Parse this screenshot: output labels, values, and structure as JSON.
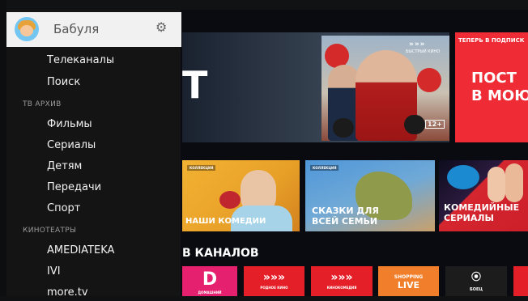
{
  "profile": {
    "name": "Бабуля",
    "settings_icon": "gear-icon",
    "avatar_icon": "avatar"
  },
  "menu": {
    "top_items": [
      {
        "label": "Телеканалы"
      },
      {
        "label": "Поиск"
      }
    ],
    "tv_archive": {
      "section_label": "ТВ АРХИВ",
      "items": [
        {
          "label": "Фильмы"
        },
        {
          "label": "Сериалы"
        },
        {
          "label": "Детям"
        },
        {
          "label": "Передачи"
        },
        {
          "label": "Спорт"
        }
      ]
    },
    "cinemas": {
      "section_label": "КИНОТЕАТРЫ",
      "items": [
        {
          "label": "AMEDIATEKA"
        },
        {
          "label": "IVI"
        },
        {
          "label": "more.tv"
        }
      ]
    }
  },
  "hero": {
    "title_fragment": "Т",
    "brand": "»»»",
    "brand_sub": "БЫСТРЫЙ КИНО",
    "age_rating": "12+"
  },
  "promo": {
    "tag": "ТЕПЕРЬ В ПОДПИСК",
    "line1": "ПОСТ",
    "line2": "В МОЮ"
  },
  "collections": [
    {
      "badge": "КОЛЛЕКЦИЯ",
      "title": "НАШИ КОМЕДИИ"
    },
    {
      "badge": "КОЛЛЕКЦИЯ",
      "title_line1": "СКАЗКИ ДЛЯ",
      "title_line2": "ВСЕЙ СЕМЬИ"
    },
    {
      "title_line1": "КОМЕДИЙНЫЕ",
      "title_line2": "СЕРИАЛЫ"
    }
  ],
  "channels_section": {
    "title": "В КАНАЛОВ"
  },
  "channels": [
    {
      "logo": "D",
      "sub": "ДОМАШНИЙ"
    },
    {
      "logo": "»»»",
      "sub": "РОДНОЕ КИНО"
    },
    {
      "logo": "»»»",
      "sub": "КИНОКОМЕДИЯ"
    },
    {
      "logo": "SHOPPING",
      "sub": "LIVE"
    },
    {
      "logo": "⦿",
      "sub": "БОЕЦ"
    }
  ],
  "colors": {
    "accent_red": "#e41f28",
    "sidebar_bg": "#141414",
    "profile_bg": "#f1f1f1"
  }
}
